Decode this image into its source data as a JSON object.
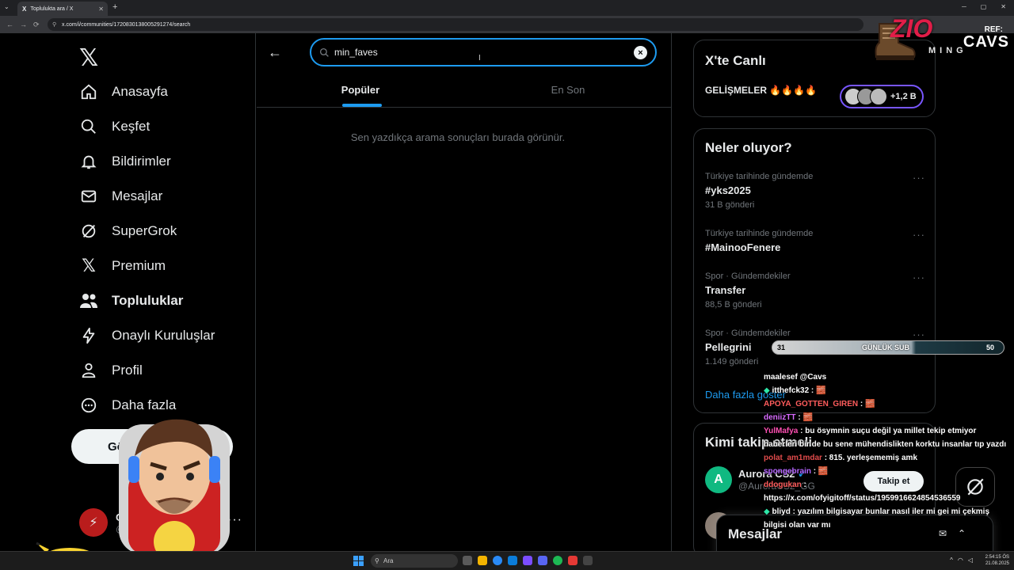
{
  "browser": {
    "tab_title": "Toplulukta ara / X",
    "url": "x.com/i/communities/1720830138005291274/search"
  },
  "nav": {
    "items": [
      {
        "label": "Anasayfa",
        "icon": "home-icon"
      },
      {
        "label": "Keşfet",
        "icon": "search-icon"
      },
      {
        "label": "Bildirimler",
        "icon": "bell-icon"
      },
      {
        "label": "Mesajlar",
        "icon": "mail-icon"
      },
      {
        "label": "SuperGrok",
        "icon": "grok-icon"
      },
      {
        "label": "Premium",
        "icon": "x-icon"
      },
      {
        "label": "Topluluklar",
        "icon": "communities-icon"
      },
      {
        "label": "Onaylı Kuruluşlar",
        "icon": "lightning-icon"
      },
      {
        "label": "Profil",
        "icon": "person-icon"
      },
      {
        "label": "Daha fazla",
        "icon": "more-circle-icon"
      }
    ],
    "post_button": "Gönder",
    "account_name": "C",
    "account_handle": "@c"
  },
  "search": {
    "value": "min_faves",
    "tabs": [
      "Popüler",
      "En Son"
    ],
    "hint": "Sen yazdıkça arama sonuçları burada görünür."
  },
  "live": {
    "title": "X'te Canlı",
    "event": "GELİŞMELER 🔥🔥🔥🔥",
    "listeners": "+1,2 B"
  },
  "trends": {
    "title": "Neler oluyor?",
    "items": [
      {
        "meta": "Türkiye tarihinde gündemde",
        "name": "#yks2025",
        "count": "31 B gönderi"
      },
      {
        "meta": "Türkiye tarihinde gündemde",
        "name": "#MainooFenere",
        "count": ""
      },
      {
        "meta": "Spor · Gündemdekiler",
        "name": "Transfer",
        "count": "88,5 B gönderi"
      },
      {
        "meta": "Spor · Gündemdekiler",
        "name": "Pellegrini",
        "count": "1.149 gönderi"
      }
    ],
    "show_more": "Daha fazla göster"
  },
  "who_to_follow": {
    "title": "Kimi takip etmeli",
    "suggestion_name": "Aurora CS2",
    "suggestion_handle": "@AuroraCS2_GG",
    "follow_label": "Takip et"
  },
  "messages": {
    "label": "Mesajlar"
  },
  "overlay": {
    "sub_current": "31",
    "sub_label": "GÜNLÜK SUB",
    "sub_goal": "50",
    "sub_progress_fraction": 0.62,
    "ref_label": "REF:",
    "ref_name": "CAVS",
    "logo_text": "ZIO",
    "logo_sub": "MING",
    "chat": [
      {
        "user": "",
        "text": "maalesef @Cavs"
      },
      {
        "user": "itthefck32",
        "text": " : 🧱"
      },
      {
        "user": "APOYA_GOTTEN_GIREN",
        "text": " : 🧱"
      },
      {
        "user": "deniizTT",
        "text": " : 🧱"
      },
      {
        "user": "YulMafya",
        "text": " : bu ösymnin suçu değil ya millet tekip etmiyor haberleri bir de bu sene mühendislikten korktu insanlar tıp yazdı"
      },
      {
        "user": "polat_am1mdar",
        "text": " : 815. yerleşememiş amk"
      },
      {
        "user": "spongebrain",
        "text": " : 🧱"
      },
      {
        "user": "ddogukan",
        "text": " :"
      },
      {
        "user": "",
        "text": "https://x.com/ofyigitoff/status/1959916624854536559"
      },
      {
        "user": "bliyd",
        "text": " : yazılım bilgisayar bunlar nasıl iler mi gei mi çekmiş bilgisi olan var mı"
      }
    ]
  },
  "taskbar": {
    "search_placeholder": "Ara",
    "time": "2:54:15 ÖS",
    "date": "21.08.2025"
  },
  "colors": {
    "accent": "#1d9bf0",
    "background": "#000000",
    "border": "#2f3336",
    "muted": "#71767b"
  }
}
